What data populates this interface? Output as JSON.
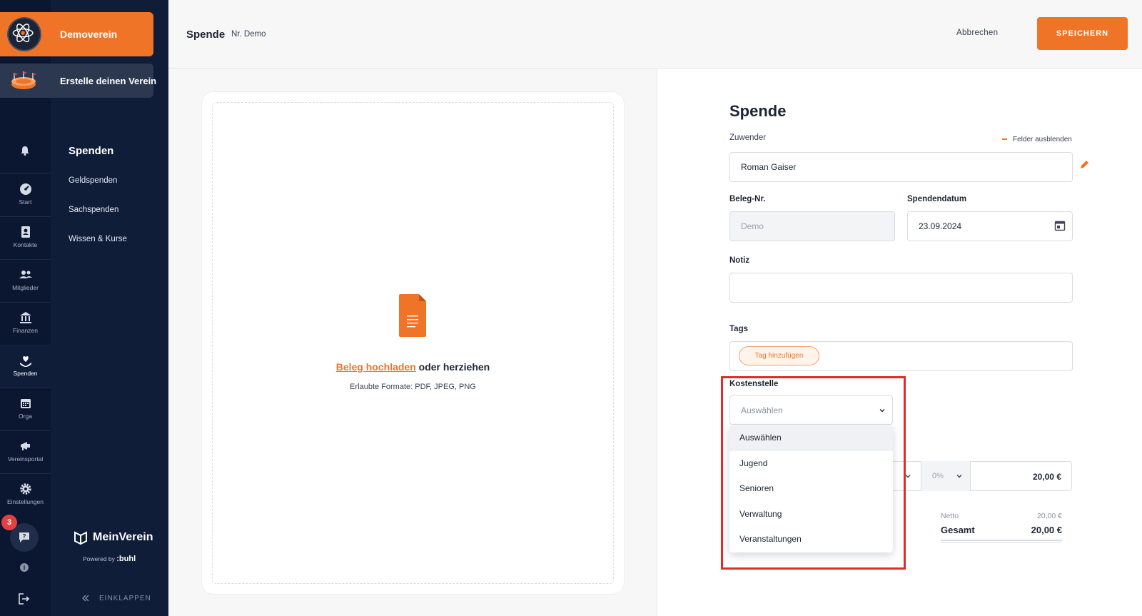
{
  "org": {
    "name": "Demoverein",
    "create_label": "Erstelle deinen Verein"
  },
  "rail": {
    "items": [
      {
        "label": "Start"
      },
      {
        "label": "Kontakte"
      },
      {
        "label": "Mitglieder"
      },
      {
        "label": "Finanzen"
      },
      {
        "label": "Spenden"
      },
      {
        "label": "Orga"
      },
      {
        "label": "Vereinsportal"
      },
      {
        "label": "Einstellungen"
      }
    ],
    "chat_badge": "3"
  },
  "submenu": {
    "title": "Spenden",
    "links": [
      "Geldspenden",
      "Sachspenden",
      "Wissen & Kurse"
    ]
  },
  "brand": {
    "name": "MeinVerein",
    "powered_prefix": "Powered by",
    "powered_by": ":buhl"
  },
  "collapse_label": "EINKLAPPEN",
  "header": {
    "title": "Spende",
    "subtitle": "Nr. Demo",
    "cancel_label": "Abbrechen",
    "save_label": "SPEICHERN"
  },
  "upload": {
    "link_label": "Beleg hochladen",
    "rest_label": "oder herziehen",
    "formats": "Erlaubte Formate: PDF, JPEG, PNG"
  },
  "form": {
    "title": "Spende",
    "zuwender_label": "Zuwender",
    "hide_fields_label": "Felder ausblenden",
    "zuwender_value": "Roman Gaiser",
    "beleg_label": "Beleg-Nr.",
    "beleg_placeholder": "Demo",
    "datum_label": "Spendendatum",
    "datum_value": "23.09.2024",
    "notiz_label": "Notiz",
    "notiz_value": "",
    "tags_label": "Tags",
    "tag_add_label": "Tag hinzufügen",
    "kostenstelle_label": "Kostenstelle",
    "kostenstelle_selected": "Auswählen",
    "kostenstelle_options": [
      "Auswählen",
      "Jugend",
      "Senioren",
      "Verwaltung",
      "Veranstaltungen"
    ],
    "tax_value": "0%",
    "amount_value": "20,00 €",
    "netto_label": "Netto",
    "netto_value": "20,00 €",
    "gesamt_label": "Gesamt",
    "gesamt_value": "20,00 €"
  },
  "colors": {
    "accent": "#f07428",
    "sidebar": "#0f1d39",
    "highlight": "#e42b2b"
  }
}
